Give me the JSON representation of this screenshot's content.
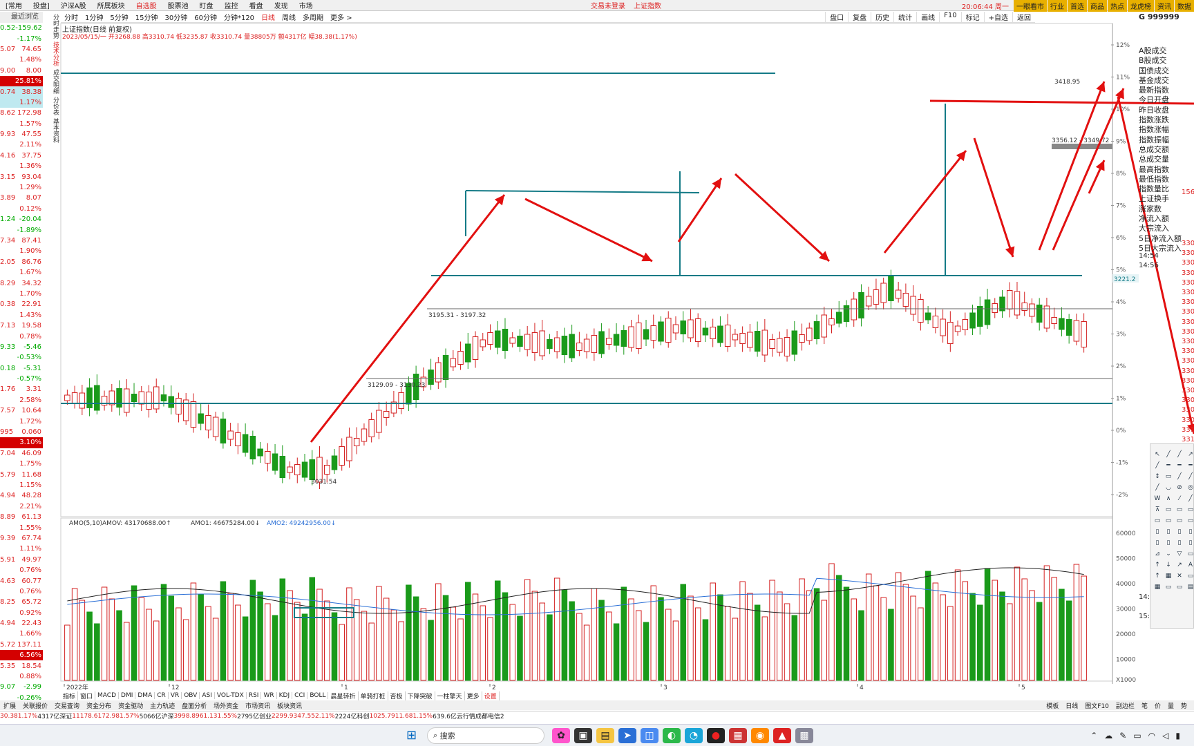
{
  "menubar": {
    "items": [
      "[常用",
      "投盘]",
      "沪深A股",
      "所属板块",
      "自选股",
      "股票池",
      "盯盘",
      "监控",
      "看盘",
      "发现",
      "市场"
    ],
    "center": [
      "交易未登录",
      "上证指数"
    ],
    "clock": "20:06:44 周一",
    "right_buttons": [
      "一眼看市",
      "行业",
      "首选",
      "商品",
      "热点",
      "龙虎榜",
      "资讯",
      "数据"
    ]
  },
  "periodbar": {
    "items": [
      "分时",
      "1分钟",
      "5分钟",
      "15分钟",
      "30分钟",
      "60分钟",
      "分钟*120",
      "日线",
      "周线",
      "多周期",
      "更多 >"
    ],
    "active": "日线",
    "tools": [
      "盘口",
      "复盘",
      "历史",
      "统计",
      "画线",
      "F10",
      "标记",
      "+自选",
      "返回"
    ]
  },
  "leftpanel": {
    "header": "最近浏览",
    "rows": [
      {
        "l": "0.52",
        "r": "-159.62",
        "c": "g"
      },
      {
        "l": "",
        "r": "-1.17%",
        "c": "g"
      },
      {
        "l": "5.07",
        "r": "74.65",
        "c": ""
      },
      {
        "l": "",
        "r": "1.48%",
        "c": ""
      },
      {
        "l": "9.00",
        "r": "8.00",
        "c": ""
      },
      {
        "l": "",
        "r": "25.81%",
        "c": "hl"
      },
      {
        "l": "0.74",
        "r": "38.38",
        "c": "cy"
      },
      {
        "l": "",
        "r": "1.17%",
        "c": "cy"
      },
      {
        "l": "8.62",
        "r": "172.98",
        "c": ""
      },
      {
        "l": "",
        "r": "1.57%",
        "c": ""
      },
      {
        "l": "9.93",
        "r": "47.55",
        "c": ""
      },
      {
        "l": "",
        "r": "2.11%",
        "c": ""
      },
      {
        "l": "4.16",
        "r": "37.75",
        "c": ""
      },
      {
        "l": "",
        "r": "1.36%",
        "c": ""
      },
      {
        "l": "3.15",
        "r": "93.04",
        "c": ""
      },
      {
        "l": "",
        "r": "1.29%",
        "c": ""
      },
      {
        "l": "3.89",
        "r": "8.07",
        "c": ""
      },
      {
        "l": "",
        "r": "0.12%",
        "c": ""
      },
      {
        "l": "1.24",
        "r": "-20.04",
        "c": "g"
      },
      {
        "l": "",
        "r": "-1.89%",
        "c": "g"
      },
      {
        "l": "7.34",
        "r": "87.41",
        "c": ""
      },
      {
        "l": "",
        "r": "1.90%",
        "c": ""
      },
      {
        "l": "2.05",
        "r": "86.76",
        "c": ""
      },
      {
        "l": "",
        "r": "1.67%",
        "c": ""
      },
      {
        "l": "8.29",
        "r": "34.32",
        "c": ""
      },
      {
        "l": "",
        "r": "1.70%",
        "c": ""
      },
      {
        "l": "0.38",
        "r": "22.91",
        "c": ""
      },
      {
        "l": "",
        "r": "1.43%",
        "c": ""
      },
      {
        "l": "7.13",
        "r": "19.58",
        "c": ""
      },
      {
        "l": "",
        "r": "0.78%",
        "c": ""
      },
      {
        "l": "9.33",
        "r": "-5.46",
        "c": "g"
      },
      {
        "l": "",
        "r": "-0.53%",
        "c": "g"
      },
      {
        "l": "0.18",
        "r": "-5.31",
        "c": "g"
      },
      {
        "l": "",
        "r": "-0.57%",
        "c": "g"
      },
      {
        "l": "1.76",
        "r": "3.31",
        "c": ""
      },
      {
        "l": "",
        "r": "2.58%",
        "c": ""
      },
      {
        "l": "7.57",
        "r": "10.64",
        "c": ""
      },
      {
        "l": "",
        "r": "1.72%",
        "c": ""
      },
      {
        "l": "995",
        "r": "0.060",
        "c": ""
      },
      {
        "l": "",
        "r": "3.10%",
        "c": "hl"
      },
      {
        "l": "7.04",
        "r": "46.09",
        "c": ""
      },
      {
        "l": "",
        "r": "1.75%",
        "c": ""
      },
      {
        "l": "5.79",
        "r": "11.68",
        "c": ""
      },
      {
        "l": "",
        "r": "1.15%",
        "c": ""
      },
      {
        "l": "4.94",
        "r": "48.28",
        "c": ""
      },
      {
        "l": "",
        "r": "2.21%",
        "c": ""
      },
      {
        "l": "8.89",
        "r": "61.13",
        "c": ""
      },
      {
        "l": "",
        "r": "1.55%",
        "c": ""
      },
      {
        "l": "9.39",
        "r": "67.74",
        "c": ""
      },
      {
        "l": "",
        "r": "1.11%",
        "c": ""
      },
      {
        "l": "5.91",
        "r": "49.97",
        "c": ""
      },
      {
        "l": "",
        "r": "0.76%",
        "c": ""
      },
      {
        "l": "4.63",
        "r": "60.77",
        "c": ""
      },
      {
        "l": "",
        "r": "0.76%",
        "c": ""
      },
      {
        "l": "8.25",
        "r": "65.72",
        "c": ""
      },
      {
        "l": "",
        "r": "0.92%",
        "c": ""
      },
      {
        "l": "4.94",
        "r": "22.43",
        "c": ""
      },
      {
        "l": "",
        "r": "1.66%",
        "c": ""
      },
      {
        "l": "5.72",
        "r": "137.11",
        "c": ""
      },
      {
        "l": "",
        "r": "6.56%",
        "c": "hl"
      },
      {
        "l": "5.35",
        "r": "18.54",
        "c": ""
      },
      {
        "l": "",
        "r": "0.88%",
        "c": ""
      },
      {
        "l": "9.07",
        "r": "-2.99",
        "c": "g"
      },
      {
        "l": "",
        "r": "-0.26%",
        "c": "g"
      }
    ]
  },
  "sidetabs": [
    "分时走势",
    "技术分析",
    "成交明细",
    "分价表",
    "基本资料"
  ],
  "chart": {
    "title": "上证指数(日线 前复权)",
    "info": "2023/05/15/一 开3268.88 高3310.74 低3235.87 收3310.74 量38805万 额4317亿 幅38.38(1.17%)",
    "annotations": [
      "3418.95",
      "3356.12 - 3349.72",
      "3195.31 - 3197.32",
      "3129.09 - 3130.23",
      "3031.54",
      "3221.2"
    ],
    "pct_axis": [
      "12%",
      "11%",
      "10%",
      "9%",
      "8%",
      "7%",
      "6%",
      "5%",
      "4%",
      "3%",
      "2%",
      "1%",
      "0%",
      "-1%",
      "-2%"
    ],
    "date_labels": [
      "2022年",
      "12",
      "1",
      "2",
      "3",
      "4",
      "5"
    ],
    "amo_legend": {
      "label": "AMO(5,10)",
      "amov": "AMOV: 43170688.00↑",
      "amo1": "AMO1: 46675284.00↓",
      "amo2": "AMO2: 49242956.00↓"
    },
    "vol_axis": [
      "60000",
      "50000",
      "40000",
      "30000",
      "20000",
      "10000",
      "X1000"
    ],
    "colors": {
      "up": "#d42020",
      "down": "#1a9a1a",
      "hline": "#137a86",
      "arrow": "#e21010"
    }
  },
  "chart_data": {
    "type": "candlestick",
    "series": [
      {
        "name": "AMO1",
        "values": []
      },
      {
        "name": "AMO2",
        "values": []
      }
    ],
    "candles_up": [
      1,
      1,
      1,
      0,
      0,
      1,
      1,
      0,
      1,
      0,
      1,
      1,
      1,
      0,
      0,
      1,
      1,
      1,
      0,
      1,
      1,
      0,
      1,
      1,
      0,
      0,
      0,
      1,
      0,
      0,
      1,
      1,
      0,
      0,
      1,
      1,
      0,
      1,
      1,
      1,
      1,
      1,
      1,
      1,
      1,
      1,
      0,
      0,
      1,
      0,
      1,
      0,
      1,
      1,
      0,
      1,
      1,
      1,
      0,
      0,
      1,
      0,
      1,
      1,
      1,
      0,
      1,
      0,
      0,
      1,
      1,
      1,
      0,
      1,
      0,
      0,
      1,
      1,
      0,
      1,
      0,
      1,
      1,
      0,
      1,
      1,
      0,
      1,
      0,
      1,
      1,
      1,
      1,
      0,
      1,
      1,
      1,
      1,
      0,
      1,
      1,
      0,
      1,
      1,
      0,
      0,
      1,
      0,
      1,
      1,
      1,
      0,
      1,
      1,
      1,
      1,
      0,
      1,
      1,
      1,
      1,
      1,
      0,
      0,
      0,
      1,
      0,
      1,
      1,
      1,
      1,
      0,
      1,
      1,
      0,
      0,
      1,
      1
    ],
    "volume_mean": 35000,
    "ylim_volume": [
      0,
      65000
    ]
  },
  "rightpanel": {
    "code": "999999",
    "fields": [
      "A股成交",
      "B股成交",
      "国债成交",
      "基金成交",
      "最新指数",
      "今日开盘",
      "昨日收盘",
      "指数涨跌",
      "指数涨幅",
      "指数振幅",
      "总成交额",
      "总成交量",
      "最高指数",
      "最低指数",
      "指数量比",
      "上证换手",
      "涨家数",
      "净流入额",
      "大宗流入",
      "5日净流入额",
      "5日大宗流入"
    ],
    "times": [
      "14:54",
      "14:56",
      "14:57",
      "15:00"
    ],
    "prices": [
      "330",
      "330",
      "330",
      "330",
      "330",
      "330",
      "330",
      "330",
      "330",
      "330",
      "330",
      "330",
      "330",
      "330",
      "330",
      "330",
      "330",
      "330",
      "330",
      "331",
      "331",
      "331",
      "331",
      "331",
      "331",
      "331"
    ],
    "zhangjia": "156"
  },
  "indicator_tabs": [
    "指标",
    "窗口",
    "MACD",
    "DMI",
    "DMA",
    "CR",
    "VR",
    "OBV",
    "ASI",
    "VOL-TDX",
    "RSI",
    "WR",
    "KDJ",
    "CCI",
    "BOLL",
    "晨星转折",
    "单骑打桩",
    "否极",
    "下降突破",
    "一柱擎天",
    "更多",
    "设置"
  ],
  "bottom_tabs": [
    "扩展",
    "关联报价",
    "交易查询",
    "资金分布",
    "资金驱动",
    "主力轨迹",
    "盘面分析",
    "场外资金",
    "市场资讯",
    "板块资讯"
  ],
  "bottom_right": [
    "模板",
    "日线",
    "图文F10",
    "副边栏",
    "笔",
    "价",
    "量",
    "势"
  ],
  "statusbar": {
    "items": [
      {
        "t": "30.38",
        "c": "r"
      },
      {
        "t": "1.17%",
        "c": "r"
      },
      {
        "t": "4317亿",
        "c": ""
      },
      {
        "t": "深证",
        "c": ""
      },
      {
        "t": "11178.6",
        "c": "r"
      },
      {
        "t": "172.98",
        "c": "r"
      },
      {
        "t": "1.57%",
        "c": "r"
      },
      {
        "t": "5066亿",
        "c": ""
      },
      {
        "t": "沪深",
        "c": ""
      },
      {
        "t": "3998.89",
        "c": "r"
      },
      {
        "t": "61.13",
        "c": "r"
      },
      {
        "t": "1.55%",
        "c": "r"
      },
      {
        "t": "2795亿",
        "c": ""
      },
      {
        "t": "创业",
        "c": ""
      },
      {
        "t": "2299.93",
        "c": "r"
      },
      {
        "t": "47.55",
        "c": "r"
      },
      {
        "t": "2.11%",
        "c": "r"
      },
      {
        "t": "2224亿",
        "c": ""
      },
      {
        "t": "科创",
        "c": ""
      },
      {
        "t": "1025.79",
        "c": "r"
      },
      {
        "t": "11.68",
        "c": "r"
      },
      {
        "t": "1.15%",
        "c": "r"
      },
      {
        "t": "639.6亿",
        "c": ""
      },
      {
        "t": "云行情成都电信2",
        "c": ""
      }
    ]
  },
  "taskbar": {
    "search": "搜索"
  }
}
